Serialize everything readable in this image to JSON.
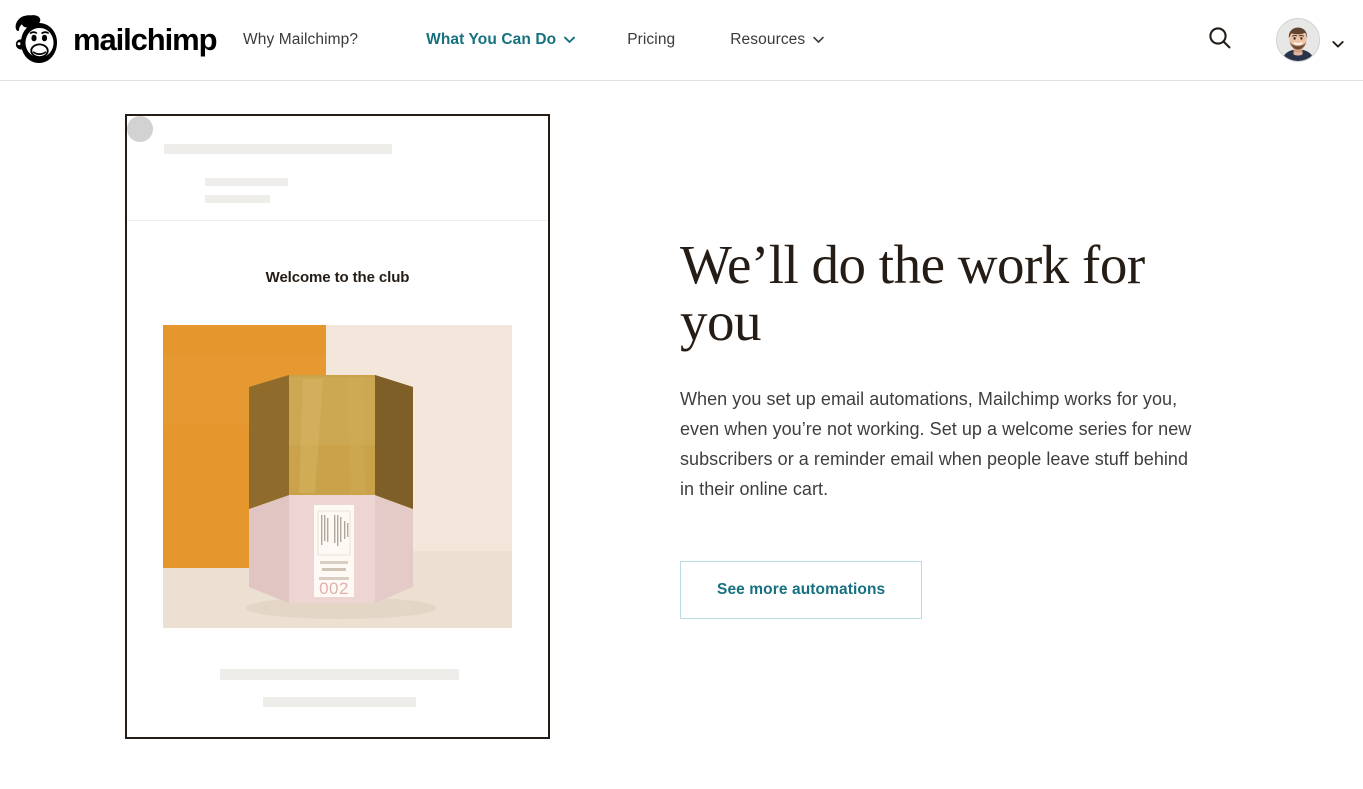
{
  "header": {
    "logo": {
      "name": "mailchimp",
      "wordmark": "mailchimp",
      "icon": "freddie-monkey-logo"
    },
    "nav": [
      {
        "label": "Why Mailchimp?",
        "active": false,
        "has_chevron": false
      },
      {
        "label": "What You Can Do",
        "active": true,
        "has_chevron": true
      },
      {
        "label": "Pricing",
        "active": false,
        "has_chevron": false
      },
      {
        "label": "Resources",
        "active": false,
        "has_chevron": true
      }
    ],
    "search_icon": "search-icon",
    "account": {
      "avatar_icon": "user-avatar-photo",
      "chevron_icon": "chevron-down-icon"
    }
  },
  "email_preview": {
    "title": "Welcome to the club",
    "product_image": {
      "alt": "hexagonal brass and blush candle vessel",
      "label_number": "002",
      "backdrop_color": "#e8982e",
      "floor_color": "#f0e4d7",
      "vessel_top_color": "#c79a3e",
      "vessel_base_color": "#ecd5d2"
    }
  },
  "main": {
    "headline": "We’ll do the work for you",
    "body": "When you set up email automations, Mailchimp works for you, even when you’re not working. Set up a welcome series for new subscribers or a reminder email when people leave stuff behind in their online cart.",
    "cta_label": "See more automations"
  },
  "colors": {
    "accent_teal": "#16707f",
    "cta_border": "#b9dce0",
    "ink": "#241c15",
    "body_text": "#3f3e3d",
    "skeleton": "#efedea",
    "header_border": "#e4e1dc"
  }
}
